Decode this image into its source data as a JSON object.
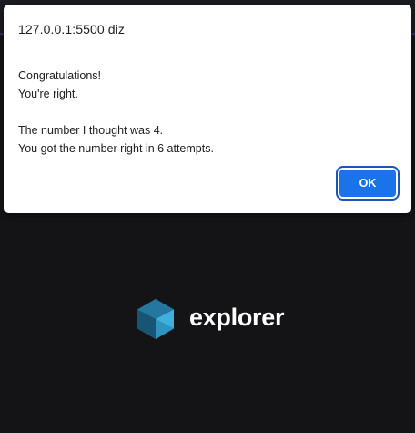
{
  "dialog": {
    "title": "127.0.0.1:5500 diz",
    "message_lines": [
      "Congratulations!",
      "You're right.",
      "",
      "The number I thought was 4.",
      "You got the number right in 6 attempts."
    ],
    "ok_label": "OK"
  },
  "brand": {
    "name": "explorer",
    "logo_icon": "explorer-hexagon-logo"
  },
  "colors": {
    "background": "#141417",
    "dialog_bg": "#ffffff",
    "accent": "#1a73e8",
    "logo_dark": "#1d6a8c",
    "logo_light": "#3ea7cf"
  }
}
